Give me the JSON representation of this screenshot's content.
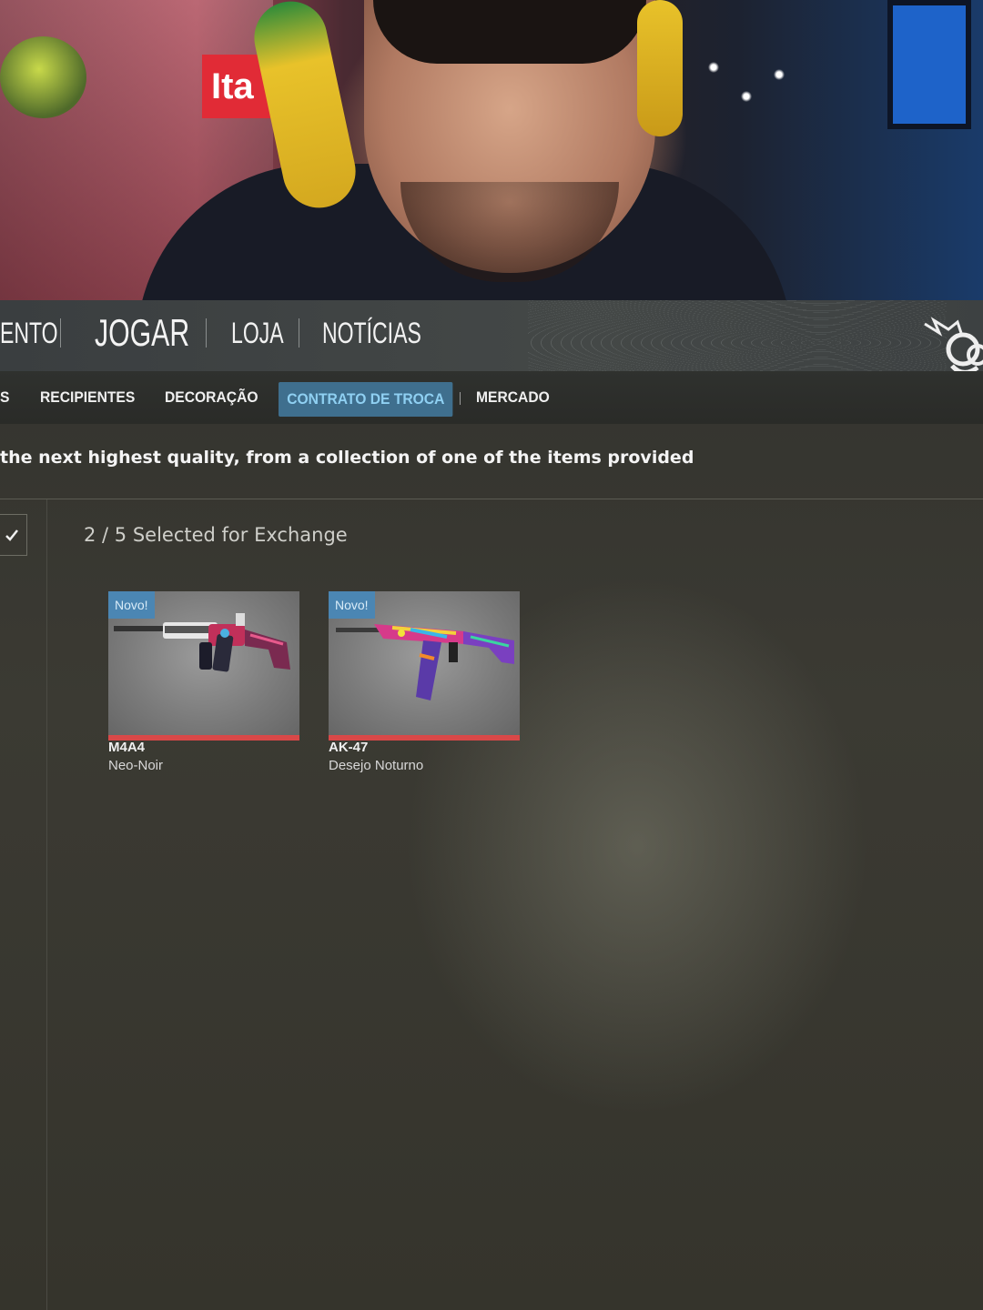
{
  "top_nav": {
    "items": [
      {
        "label": "ENTO"
      },
      {
        "label": "JOGAR"
      },
      {
        "label": "LOJA"
      },
      {
        "label": "NOTÍCIAS"
      }
    ]
  },
  "sub_nav": {
    "items": [
      {
        "label": "S"
      },
      {
        "label": "RECIPIENTES"
      },
      {
        "label": "DECORAÇÃO"
      },
      {
        "label": "CONTRATO DE TROCA",
        "active": true
      },
      {
        "label": "MERCADO"
      }
    ]
  },
  "info_text": "the next highest quality, from a collection of one of the items provided",
  "exchange": {
    "selected_text": "2 / 5 Selected for Exchange",
    "confirm_icon": "check-icon"
  },
  "items": [
    {
      "badge": "Novo!",
      "weapon": "M4A4",
      "skin": "Neo-Noir",
      "rarity_color": "#d94848"
    },
    {
      "badge": "Novo!",
      "weapon": "AK-47",
      "skin": "Desejo Noturno",
      "rarity_color": "#d94848"
    }
  ],
  "colors": {
    "accent_active_tab_bg": "#3f6f8e",
    "accent_active_tab_text": "#8fd0f2",
    "badge_bg": "#4b86b3"
  }
}
